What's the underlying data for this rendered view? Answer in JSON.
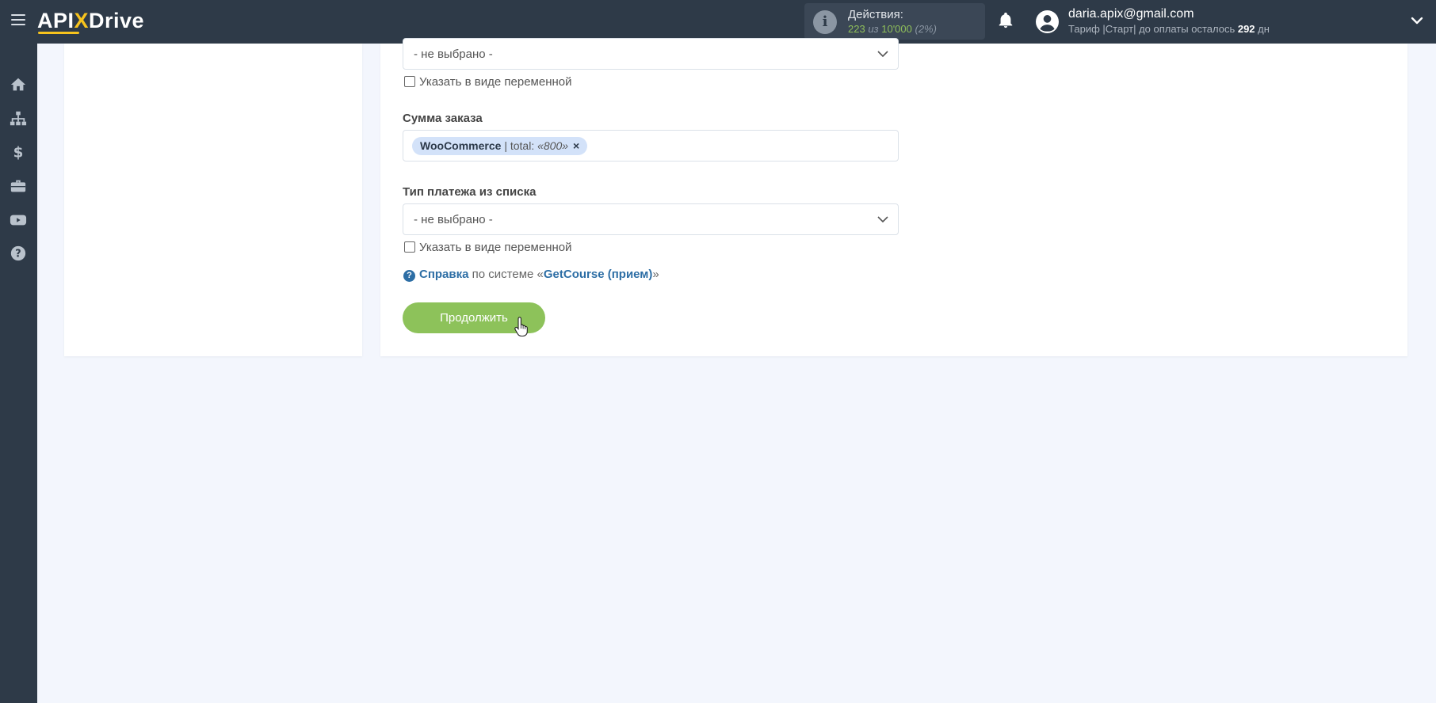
{
  "app": {
    "logo_left": "API",
    "logo_x": "X",
    "logo_right": "Drive"
  },
  "header": {
    "actions_title": "Действия:",
    "actions_used": "223",
    "actions_of": "из",
    "actions_total": "10'000",
    "actions_percent": "(2%)",
    "user_email": "daria.apix@gmail.com",
    "tariff_text": "Тариф |Старт| до оплаты осталось",
    "tariff_days": "292",
    "tariff_days_unit": "дн"
  },
  "sidebar": {
    "icons": [
      "home-icon",
      "sitemap-icon",
      "dollar-icon",
      "briefcase-icon",
      "youtube-icon",
      "help-icon"
    ]
  },
  "form": {
    "select_top_value": "- не выбрано -",
    "checkbox_top_label": "Указать в виде переменной",
    "order_sum_label": "Сумма заказа",
    "tag_source": "WooCommerce",
    "tag_field": "| total:",
    "tag_value": "«800»",
    "tag_remove": "×",
    "payment_type_label": "Тип платежа из списка",
    "payment_type_value": "- не выбрано -",
    "checkbox_bottom_label": "Указать в виде переменной",
    "help_link": "Справка",
    "help_text": "по системе «",
    "help_system": "GetCourse (прием)",
    "help_close": "»",
    "continue_button": "Продолжить"
  },
  "colors": {
    "topbar": "#2e3a48",
    "accent_yellow": "#f7c31d",
    "button_green": "#8dc25a",
    "link_blue": "#2d6ea5",
    "tag_bg": "#d3e2f9",
    "page_bg": "#f3f6fd"
  }
}
